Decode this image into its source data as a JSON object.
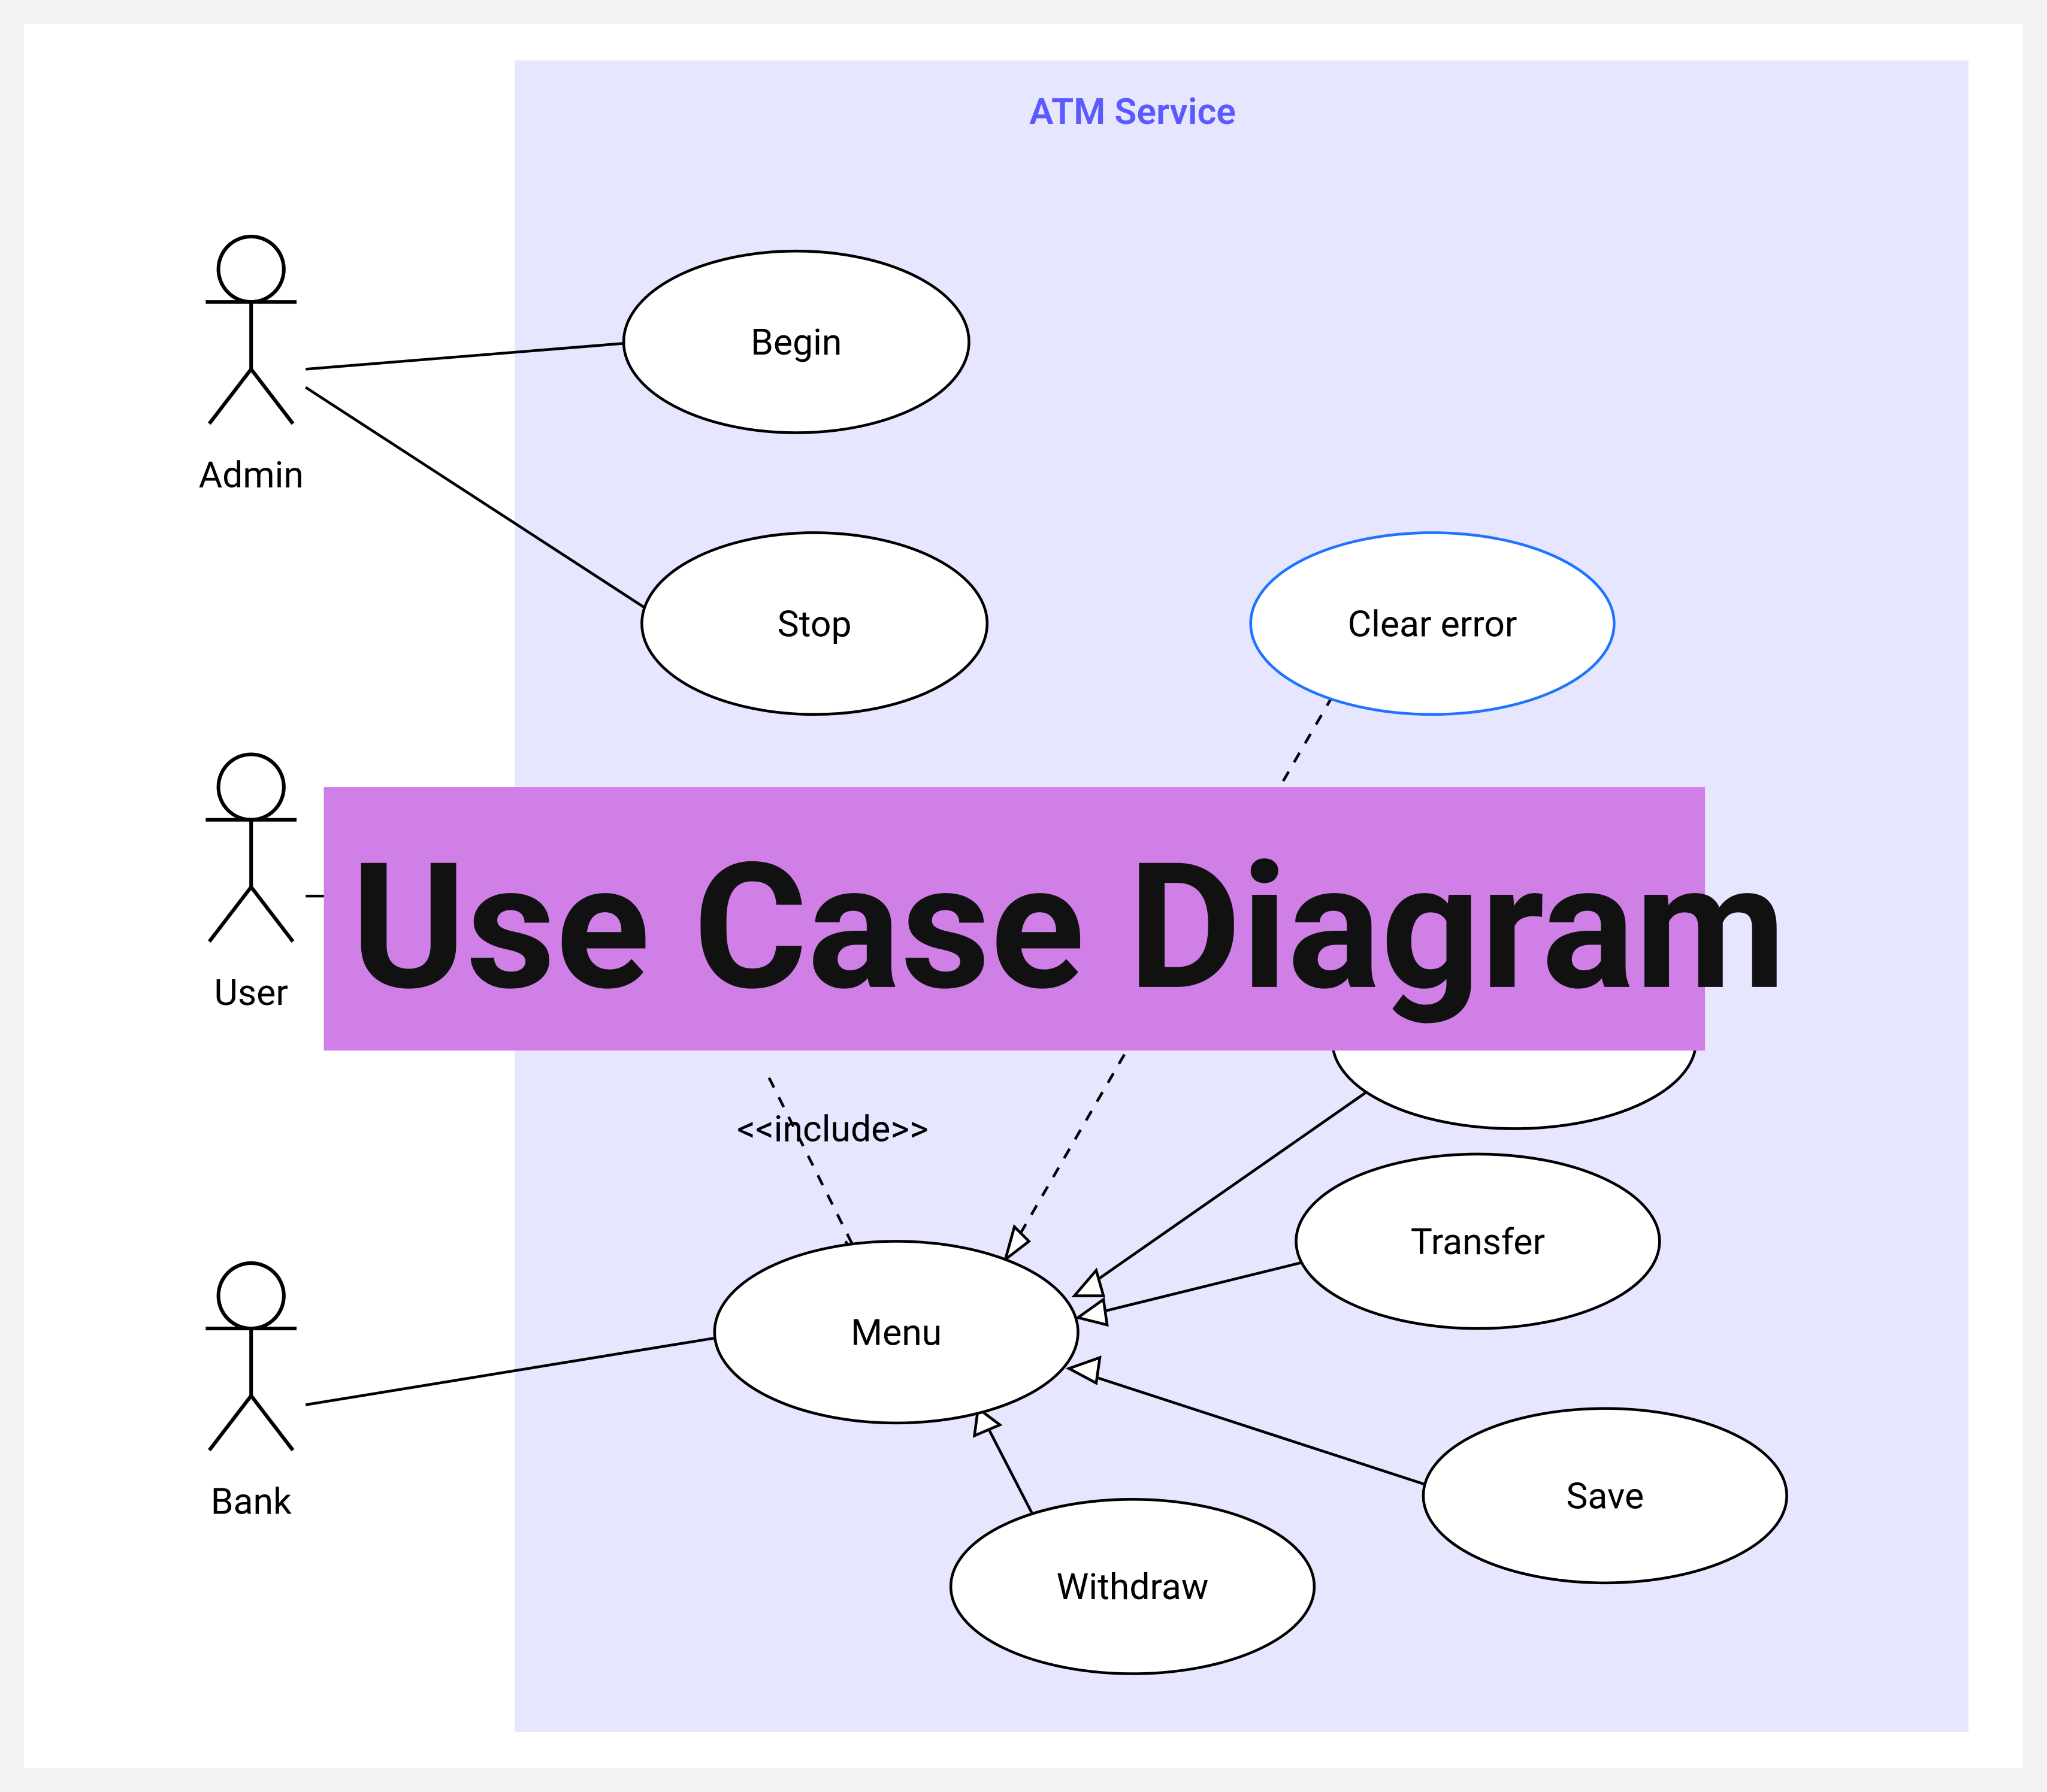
{
  "diagram": {
    "title_banner": "Use Case Diagram",
    "system": {
      "label": "ATM Service"
    },
    "actors": {
      "admin": "Admin",
      "user": "User",
      "bank": "Bank"
    },
    "usecases": {
      "begin": "Begin",
      "stop": "Stop",
      "clear_error": "Clear error",
      "menu": "Menu",
      "transfer": "Transfer",
      "withdraw": "Withdraw",
      "save": "Save"
    },
    "edge_labels": {
      "include": "<<include>>"
    }
  }
}
